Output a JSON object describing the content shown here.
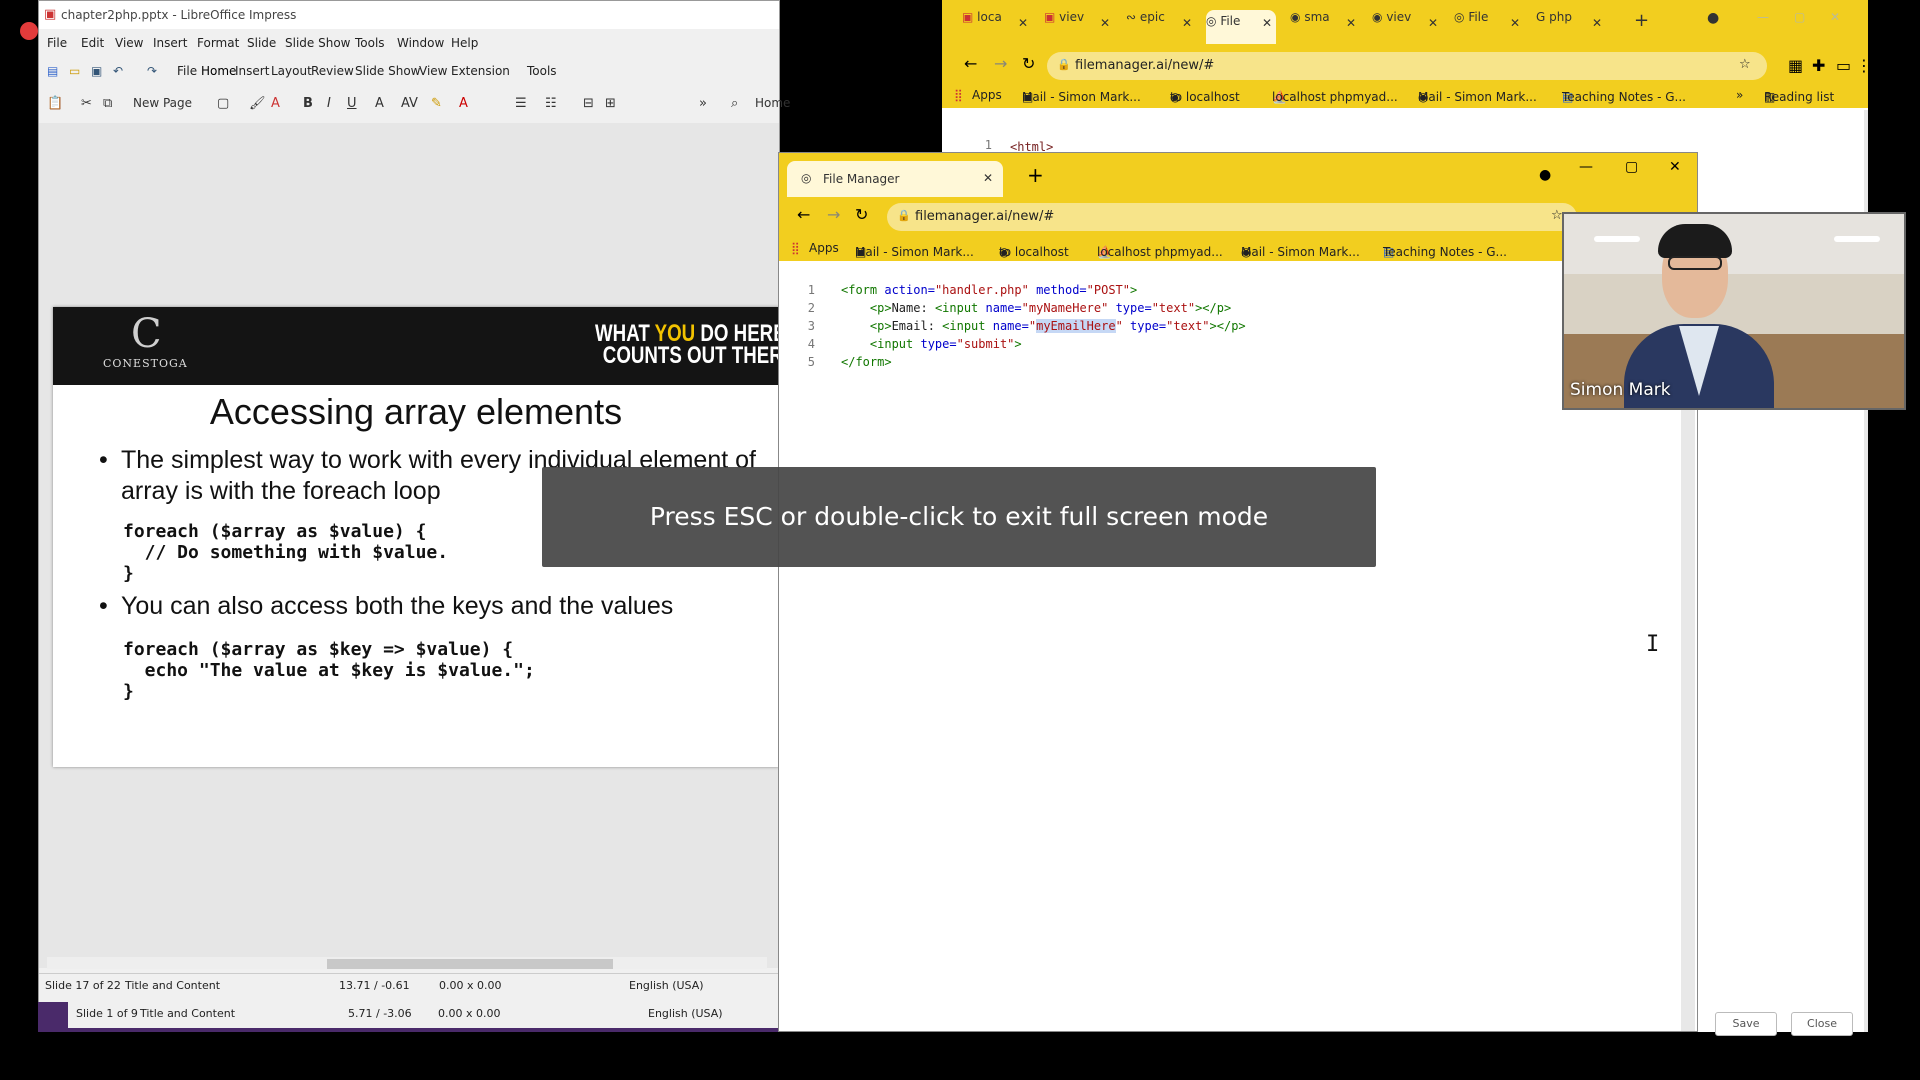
{
  "lo": {
    "title": "chapter2php.pptx - LibreOffice Impress",
    "menu": [
      "File",
      "Edit",
      "View",
      "Insert",
      "Format",
      "Slide",
      "Slide Show",
      "Tools",
      "Window",
      "Help"
    ],
    "tabs": [
      "File",
      "Home",
      "Insert",
      "Layout",
      "Review",
      "Slide Show",
      "View",
      "Extension",
      "Tools"
    ],
    "toolbar": {
      "new_page": "New Page",
      "home": "Home"
    },
    "slide": {
      "logo": "C",
      "logo_text": "CONESTOGA",
      "slogan_1a": "WHAT ",
      "slogan_1b": "YOU",
      "slogan_1c": " DO HERE",
      "slogan_2": "COUNTS OUT THER",
      "title": "Accessing array elements",
      "bullet1": "The simplest way to work with every individual element of",
      "bullet1b": "array is with the foreach loop",
      "code1": "foreach ($array as $value) {\n  // Do something with $value.\n}",
      "bullet2": "You can also access both the keys and the values",
      "code2": "foreach ($array as $key => $value) {\n  echo \"The value at $key is $value.\";\n}"
    },
    "status1": {
      "slide": "Slide 17 of 22",
      "layout": "Title and Content",
      "pos": "13.71 / -0.61",
      "size": "0.00 x 0.00",
      "lang": "English (USA)"
    },
    "status2": {
      "slide": "Slide 1 of 9",
      "layout": "Title and Content",
      "pos": "5.71 / -3.06",
      "size": "0.00 x 0.00",
      "lang": "English (USA)"
    }
  },
  "chrome_back": {
    "tabs": [
      "loca",
      "viev",
      "epic",
      "File",
      "sma",
      "viev",
      "File",
      "php"
    ],
    "url": "filemanager.ai/new/#",
    "bookmarks": [
      "Apps",
      "Mail - Simon Mark...",
      "to localhost",
      "localhost phpmyad...",
      "Mail - Simon Mark...",
      "Teaching Notes - G..."
    ],
    "reading_list": "Reading list",
    "ghost_line_no": "1",
    "ghost_line": "<html>",
    "save": "Save",
    "close": "Close"
  },
  "chrome_front": {
    "tab_title": "File Manager",
    "url": "filemanager.ai/new/#",
    "bookmarks": [
      "Apps",
      "Mail - Simon Mark...",
      "to localhost",
      "localhost phpmyad...",
      "Mail - Simon Mark...",
      "Teaching Notes - G..."
    ],
    "line_numbers": [
      "1",
      "2",
      "3",
      "4",
      "5"
    ],
    "code": {
      "l1_tag": "<form ",
      "l1_a1": "action=",
      "l1_v1": "\"handler.php\"",
      "l1_a2": " method=",
      "l1_v2": "\"POST\"",
      "l1_end": ">",
      "l2_tag": "    <p>",
      "l2_txt": "Name: ",
      "l2_in": "<input ",
      "l2_a1": "name=",
      "l2_v1": "\"myNameHere\"",
      "l2_a2": " type=",
      "l2_v2": "\"text\"",
      "l2_end": "></p>",
      "l3_tag": "    <p>",
      "l3_txt": "Email: ",
      "l3_in": "<input ",
      "l3_a1": "name=",
      "l3_q1": "\"",
      "l3_v1": "myEmailHere",
      "l3_q2": "\"",
      "l3_a2": " type=",
      "l3_v2": "\"text\"",
      "l3_end": "></p>",
      "l4_in": "    <input ",
      "l4_a1": "type=",
      "l4_v1": "\"submit\"",
      "l4_end": ">",
      "l5": "</form>"
    }
  },
  "fullscreen_notice": "Press ESC or double-click to exit full screen mode",
  "video": {
    "name": "Simon Mark"
  },
  "colors": {
    "chrome_yellow": "#f2ce1f",
    "lo_accent": "#4a2a6a",
    "highlight": "#c6d8f5"
  }
}
